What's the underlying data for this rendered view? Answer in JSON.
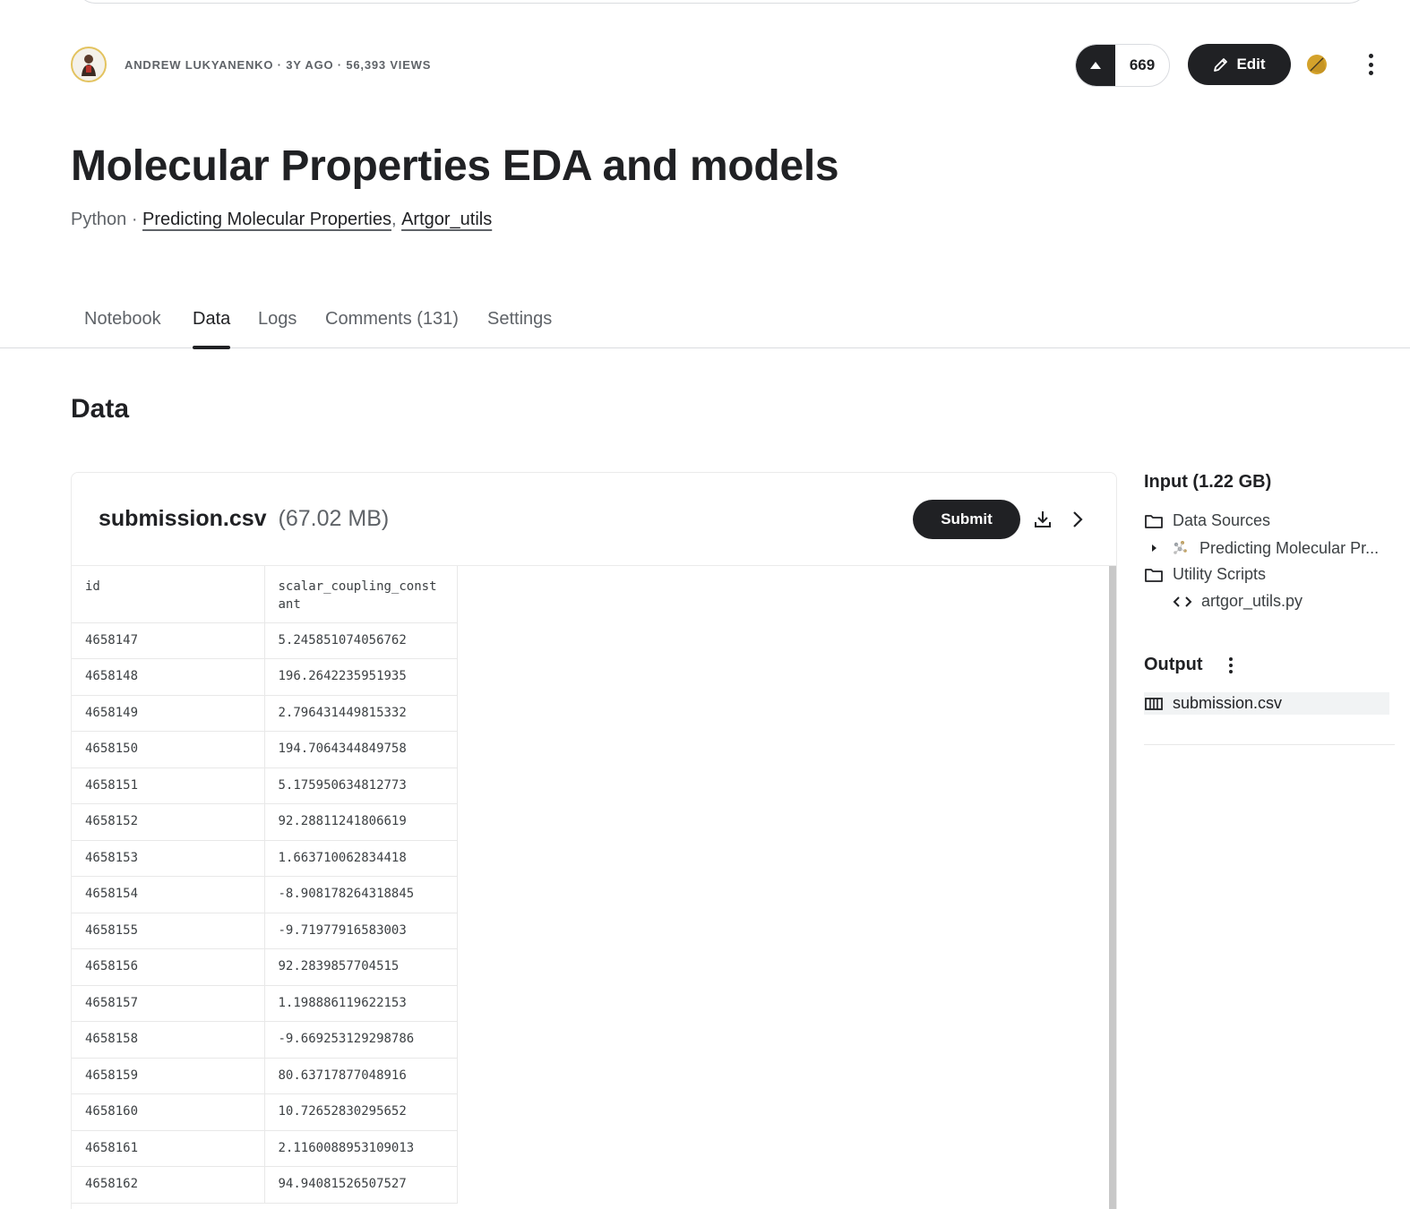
{
  "header": {
    "author_meta": "ANDREW LUKYANENKO · 3Y AGO · 56,393 VIEWS",
    "vote_count": "669",
    "edit_label": "Edit",
    "title": "Molecular Properties EDA and models",
    "language": "Python",
    "separator": " · ",
    "sources": [
      "Predicting Molecular Properties",
      "Artgor_utils"
    ],
    "source_sep": ", "
  },
  "tabs": [
    {
      "label": "Notebook",
      "active": false
    },
    {
      "label": "Data",
      "active": true
    },
    {
      "label": "Logs",
      "active": false
    },
    {
      "label": "Comments (131)",
      "active": false
    },
    {
      "label": "Settings",
      "active": false
    }
  ],
  "section_title": "Data",
  "file": {
    "name": "submission.csv",
    "size": "(67.02 MB)",
    "submit_label": "Submit",
    "columns": [
      "id",
      "scalar_coupling_constant"
    ],
    "rows": [
      [
        "4658147",
        "5.245851074056762"
      ],
      [
        "4658148",
        "196.2642235951935"
      ],
      [
        "4658149",
        "2.796431449815332"
      ],
      [
        "4658150",
        "194.7064344849758"
      ],
      [
        "4658151",
        "5.175950634812773"
      ],
      [
        "4658152",
        "92.28811241806619"
      ],
      [
        "4658153",
        "1.663710062834418"
      ],
      [
        "4658154",
        "-8.908178264318845"
      ],
      [
        "4658155",
        "-9.71977916583003"
      ],
      [
        "4658156",
        "92.2839857704515"
      ],
      [
        "4658157",
        "1.198886119622153"
      ],
      [
        "4658158",
        "-9.669253129298786"
      ],
      [
        "4658159",
        "80.63717877048916"
      ],
      [
        "4658160",
        "10.72652830295652"
      ],
      [
        "4658161",
        "2.1160088953109013"
      ],
      [
        "4658162",
        "94.94081526507527"
      ]
    ]
  },
  "sidebar": {
    "input_title": "Input (1.22 GB)",
    "data_sources_label": "Data Sources",
    "dataset_label": "Predicting Molecular Pr...",
    "utility_scripts_label": "Utility Scripts",
    "script_label": "artgor_utils.py",
    "output_title": "Output",
    "output_file": "submission.csv"
  },
  "colors": {
    "accent_dark": "#202124",
    "medal_gold": "#d4a22b",
    "avatar_ring": "#e3c35f"
  }
}
